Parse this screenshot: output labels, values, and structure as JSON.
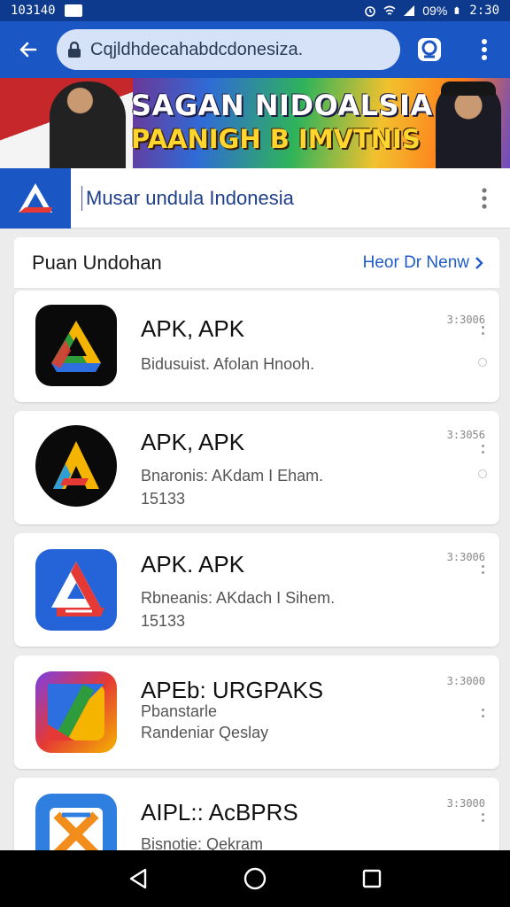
{
  "status_bar": {
    "time": "103140",
    "battery": "09%",
    "clock": "2:30"
  },
  "browser": {
    "url": "Cqjldhdecahabdcdonesiza."
  },
  "banner": {
    "line1": "SAGAN NIDOALSIA",
    "line2": "PAANIGH B IMVTNIS"
  },
  "site": {
    "title": "Musar undula Indonesia"
  },
  "section": {
    "title": "Puan Undohan",
    "link": "Heor Dr Nenw"
  },
  "apps": [
    {
      "name": "APK, APK",
      "desc1": "Bidusuist. Afolan Hnooh.",
      "desc2": "",
      "size": "3:3006"
    },
    {
      "name": "APK, APK",
      "desc1": "Bnaronis: AKdam I Eham.",
      "desc2": "15133",
      "size": "3:3056"
    },
    {
      "name": "APK. APK",
      "desc1": "Rbneanis: AKdach I Sihem.",
      "desc2": "15133",
      "size": "3:3006"
    },
    {
      "name": "APEb: URGPAKS",
      "desc1": "Pbanstarle",
      "desc2": "Randeniar Qeslay",
      "size": "3:3000"
    },
    {
      "name": "AIPL:: AcBPRS",
      "desc1": "Bisnotie: Qekram",
      "desc2": "",
      "size": "3:3000"
    }
  ],
  "colors": {
    "status_bar": "#0d3a8c",
    "browser_bar": "#1a56c4",
    "link": "#1f5bc8"
  }
}
